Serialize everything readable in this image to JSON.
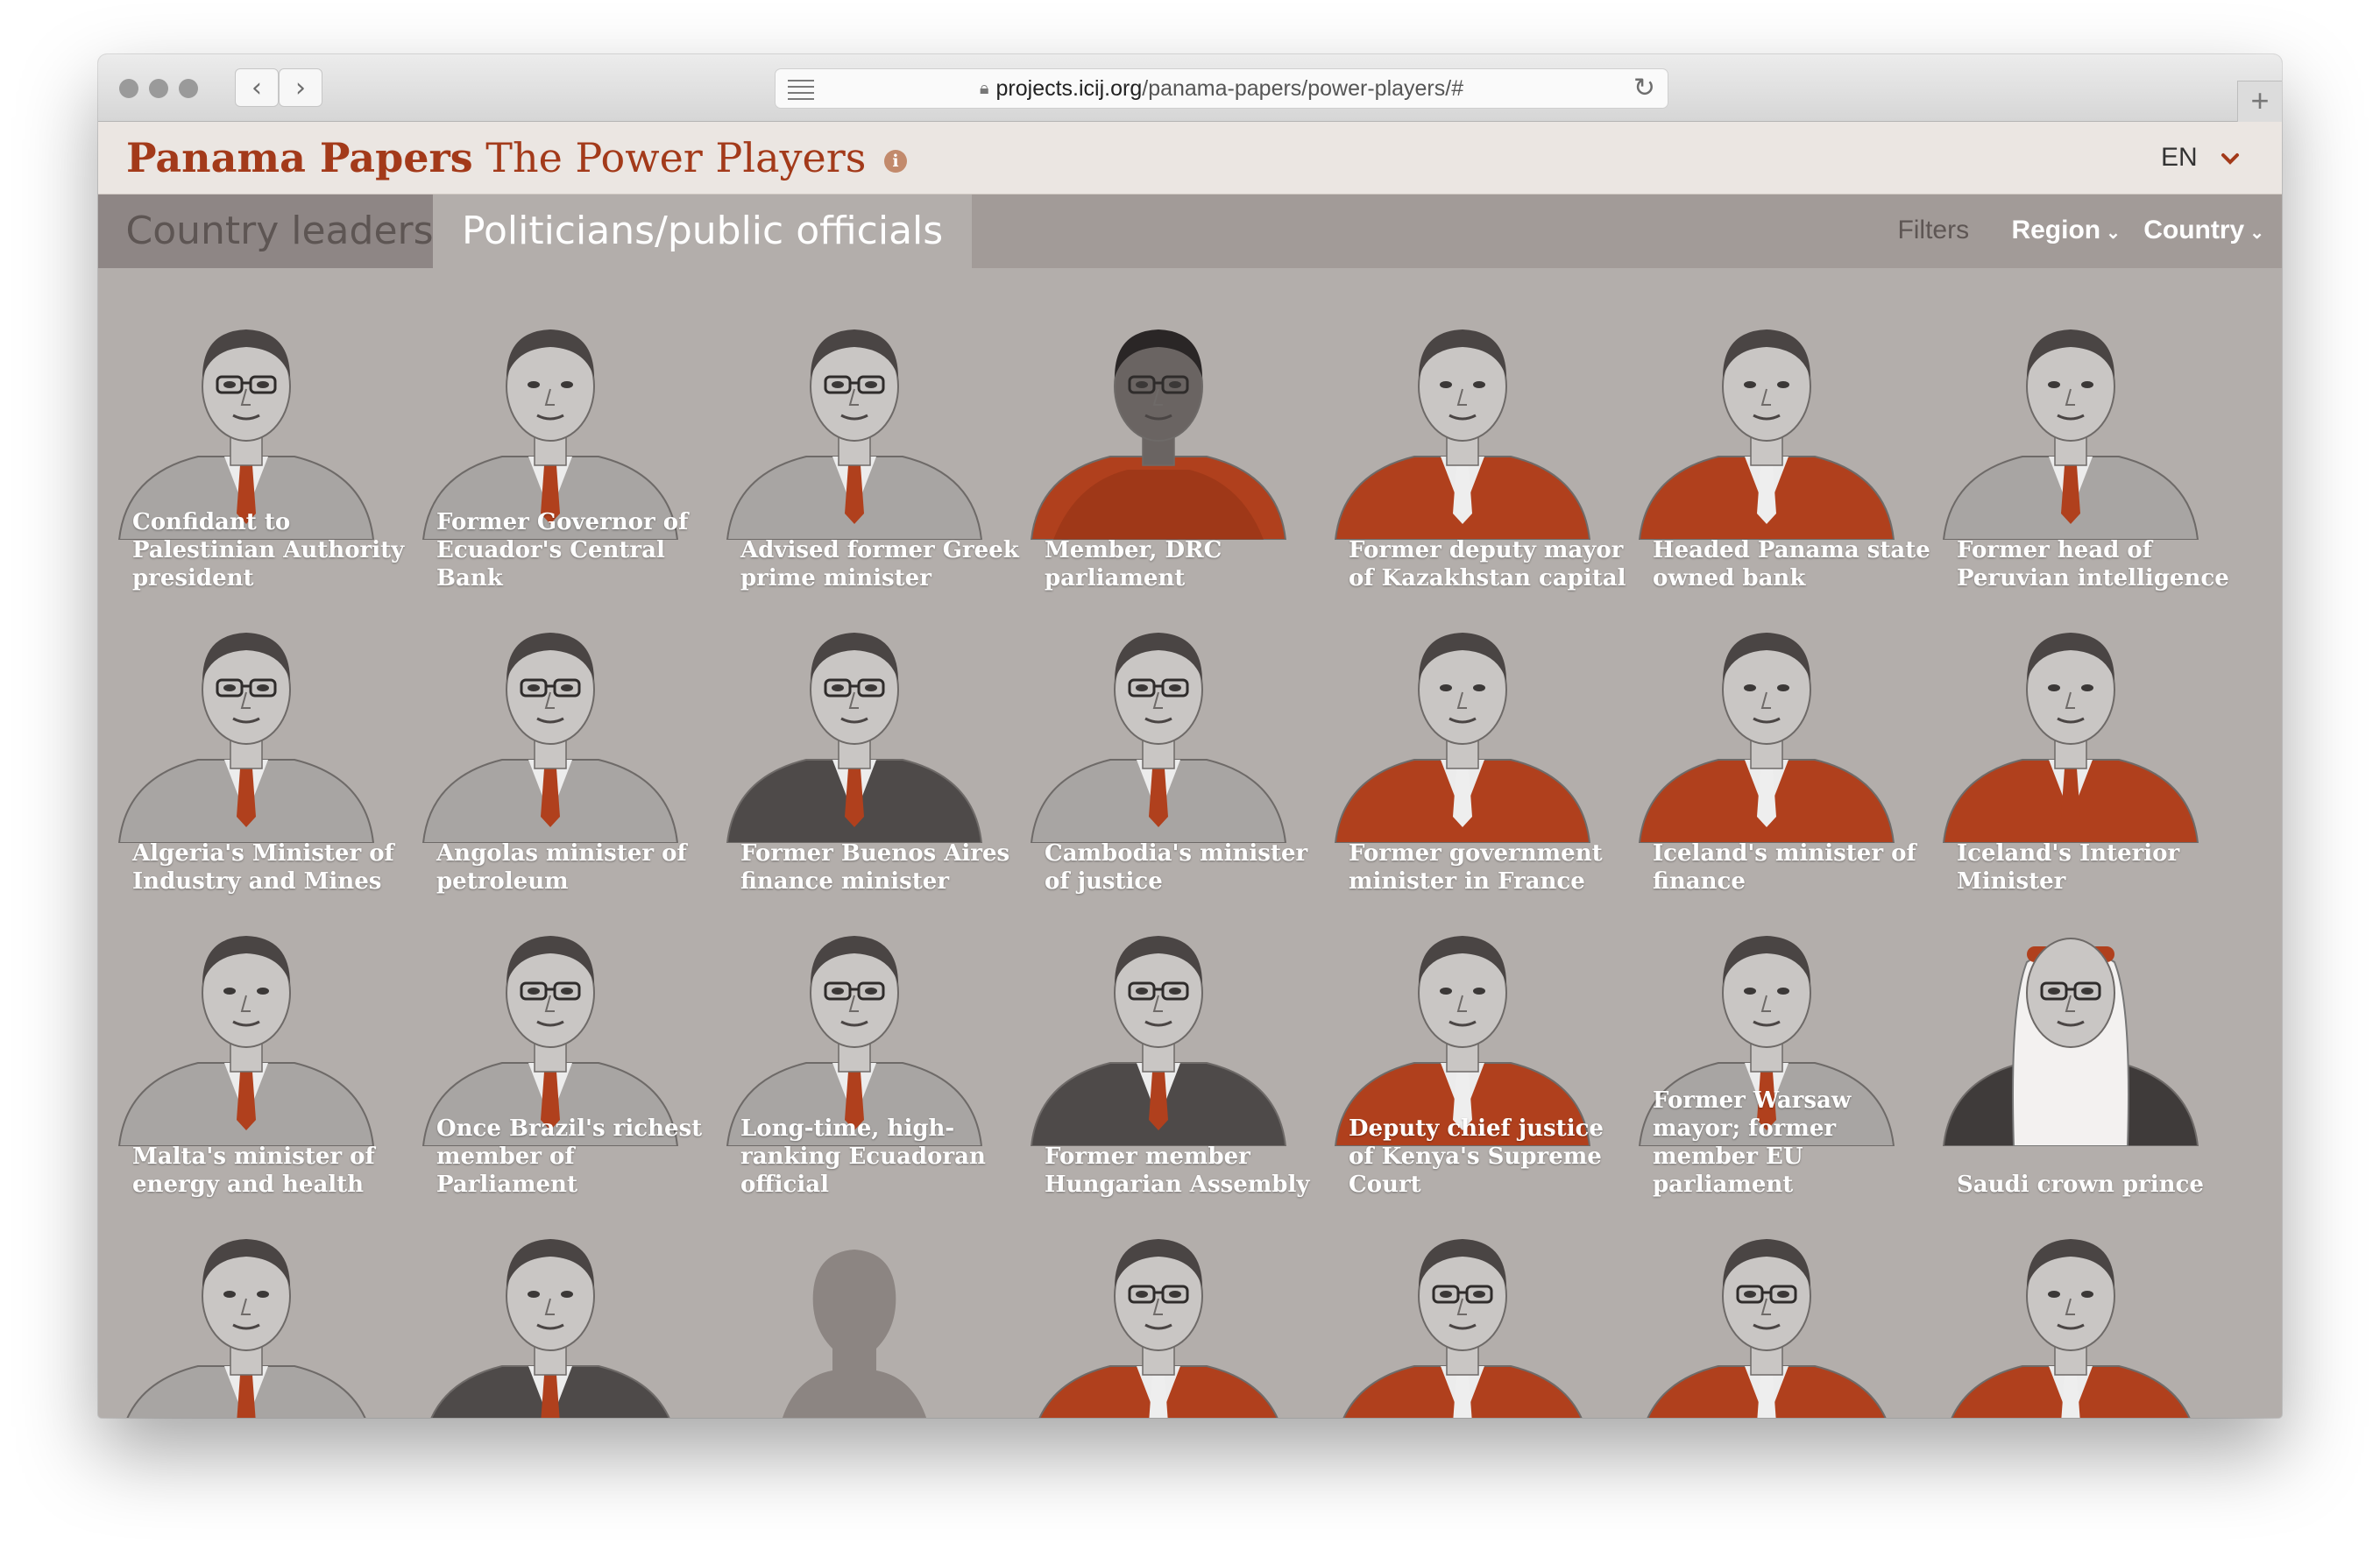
{
  "browser": {
    "url_host": "projects.icij.org",
    "url_path": "/panama-papers/power-players/#",
    "back_glyph": "‹",
    "forward_glyph": "›",
    "reload_glyph": "↻",
    "new_tab_glyph": "+"
  },
  "header": {
    "title_bold": "Panama Papers",
    "title_light": "The Power Players",
    "info_glyph": "i",
    "language": "EN",
    "language_chevron": "⌄"
  },
  "tabs": [
    {
      "label": "Country leaders",
      "active": false
    },
    {
      "label": "Politicians/public officials",
      "active": true
    }
  ],
  "filters": {
    "label": "Filters",
    "region": "Region",
    "country": "Country",
    "chevron": "⌄"
  },
  "colors": {
    "brand": "#a33a1a",
    "accent_jacket": "#b0401d",
    "background": "#b3aeab"
  },
  "people": [
    {
      "caption": "Confidant to Palestinian Authority president",
      "style": "gray",
      "glasses": true,
      "headwear": "none"
    },
    {
      "caption": "Former Governor of Ecuador's Central Bank",
      "style": "gray",
      "glasses": false,
      "headwear": "none"
    },
    {
      "caption": "Advised former Greek prime minister",
      "style": "gray",
      "glasses": true,
      "headwear": "none"
    },
    {
      "caption": "Member, DRC parliament",
      "style": "red-dress",
      "glasses": true,
      "headwear": "none"
    },
    {
      "caption": "Former deputy mayor of Kazakhstan capital",
      "style": "red",
      "glasses": false,
      "headwear": "none"
    },
    {
      "caption": "Headed Panama state owned bank",
      "style": "red",
      "glasses": false,
      "headwear": "none"
    },
    {
      "caption": "Former head of Peruvian intelligence",
      "style": "gray",
      "glasses": false,
      "headwear": "none"
    },
    {
      "caption": "Algeria's Minister of Industry and Mines",
      "style": "gray",
      "glasses": true,
      "headwear": "none"
    },
    {
      "caption": "Angolas minister of petroleum",
      "style": "gray",
      "glasses": true,
      "headwear": "none"
    },
    {
      "caption": "Former Buenos Aires finance minister",
      "style": "dark",
      "glasses": true,
      "headwear": "none"
    },
    {
      "caption": "Cambodia's minister of justice",
      "style": "gray",
      "glasses": true,
      "headwear": "none"
    },
    {
      "caption": "Former government minister in France",
      "style": "red",
      "glasses": false,
      "headwear": "none"
    },
    {
      "caption": "Iceland's minister of finance",
      "style": "red",
      "glasses": false,
      "headwear": "none"
    },
    {
      "caption": "Iceland's Interior Minister",
      "style": "red-scarf",
      "glasses": false,
      "headwear": "none"
    },
    {
      "caption": "Malta's minister of energy and health",
      "style": "gray",
      "glasses": false,
      "headwear": "none"
    },
    {
      "caption": "Once Brazil's richest member of Parliament",
      "style": "gray",
      "glasses": true,
      "headwear": "none"
    },
    {
      "caption": "Long-time, high-ranking Ecuadoran official",
      "style": "gray",
      "glasses": true,
      "headwear": "none"
    },
    {
      "caption": "Former member Hungarian Assembly",
      "style": "dark",
      "glasses": true,
      "headwear": "none"
    },
    {
      "caption": "Deputy chief justice of Kenya's Supreme Court",
      "style": "red",
      "glasses": false,
      "headwear": "none"
    },
    {
      "caption": "Former Warsaw mayor; former member EU parliament",
      "style": "gray",
      "glasses": false,
      "headwear": "none"
    },
    {
      "caption": "Saudi crown prince",
      "style": "keffiyeh",
      "glasses": true,
      "headwear": "ghutra"
    },
    {
      "caption": "",
      "style": "gray",
      "glasses": false,
      "headwear": "none"
    },
    {
      "caption": "",
      "style": "dark",
      "glasses": false,
      "headwear": "none"
    },
    {
      "caption": "",
      "style": "silhouette",
      "glasses": false,
      "headwear": "none"
    },
    {
      "caption": "",
      "style": "red",
      "glasses": true,
      "headwear": "none"
    },
    {
      "caption": "",
      "style": "red",
      "glasses": true,
      "headwear": "none"
    },
    {
      "caption": "",
      "style": "red",
      "glasses": true,
      "headwear": "none"
    },
    {
      "caption": "",
      "style": "red",
      "glasses": false,
      "headwear": "none"
    }
  ]
}
